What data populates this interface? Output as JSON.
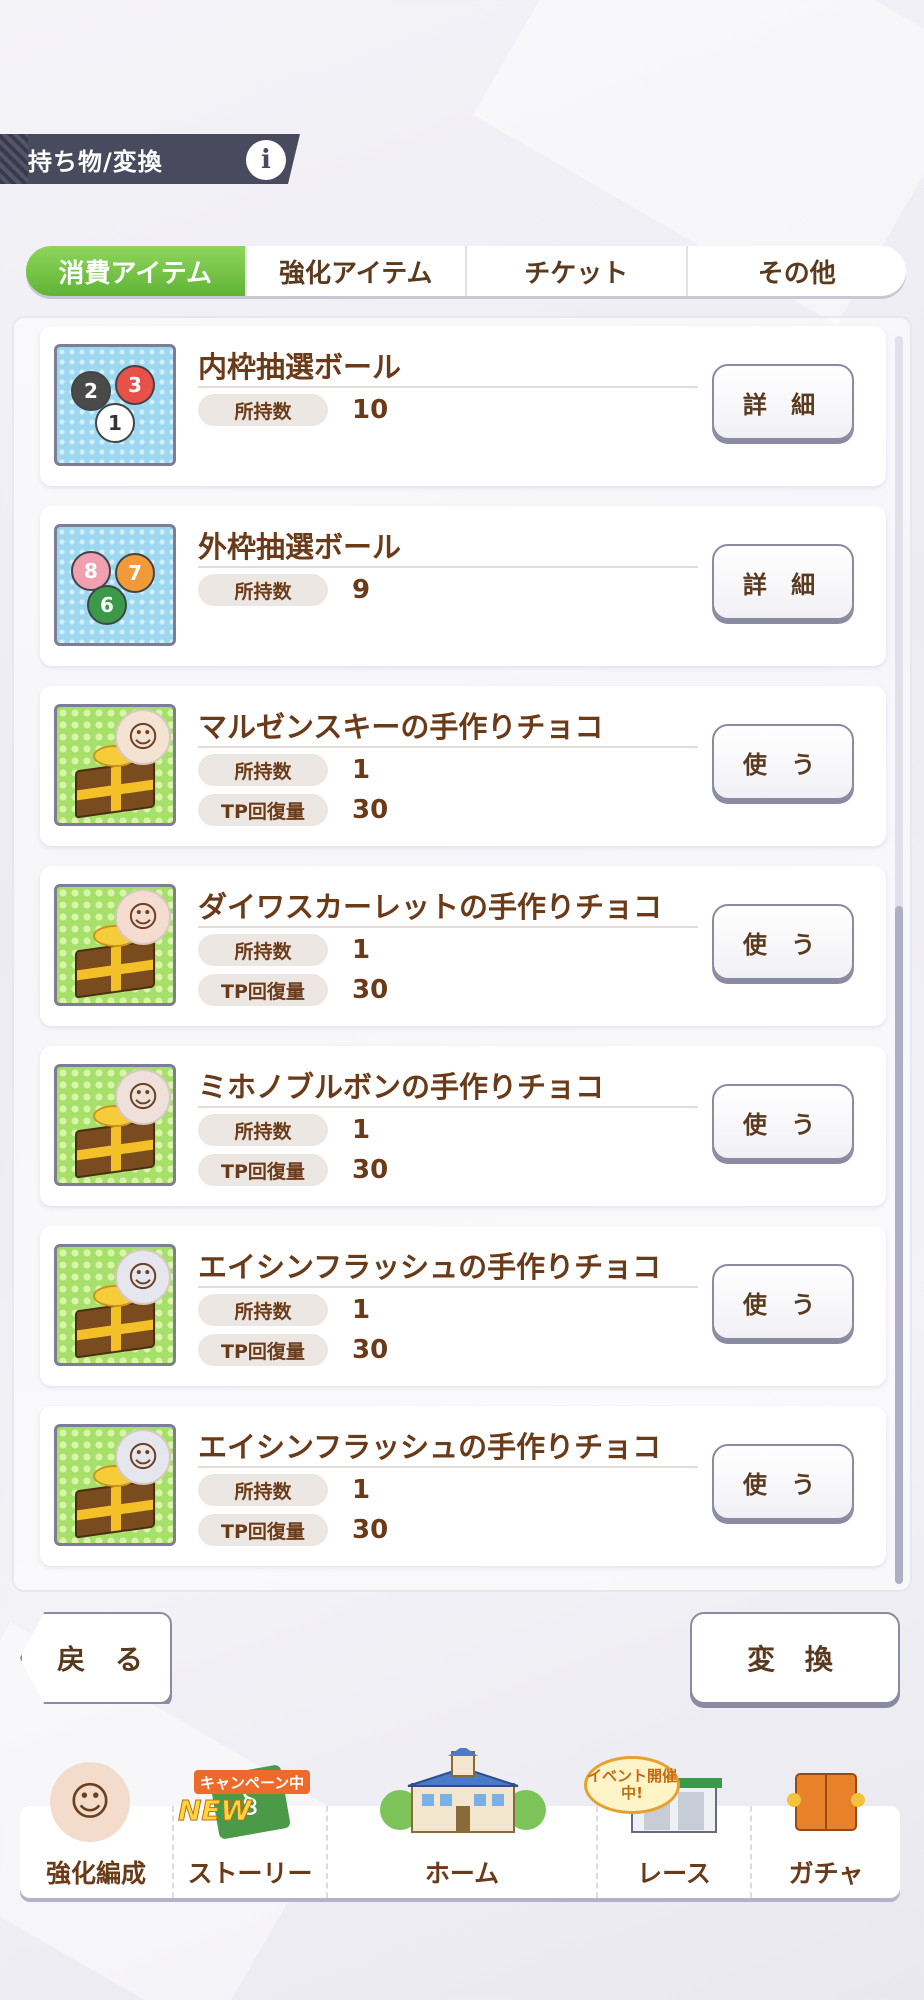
{
  "header": {
    "title": "持ち物/変換",
    "info_icon": "i"
  },
  "tabs": [
    {
      "label": "消費アイテム",
      "active": true
    },
    {
      "label": "強化アイテム",
      "active": false
    },
    {
      "label": "チケット",
      "active": false
    },
    {
      "label": "その他",
      "active": false
    }
  ],
  "items": [
    {
      "name": "内枠抽選ボール",
      "stats": [
        {
          "label": "所持数",
          "value": "10"
        }
      ],
      "button": "詳 細",
      "icon": "inner-lottery-balls-icon"
    },
    {
      "name": "外枠抽選ボール",
      "stats": [
        {
          "label": "所持数",
          "value": "9"
        }
      ],
      "button": "詳 細",
      "icon": "outer-lottery-balls-icon"
    },
    {
      "name": "マルゼンスキーの手作りチョコ",
      "stats": [
        {
          "label": "所持数",
          "value": "1"
        },
        {
          "label": "TP回復量",
          "value": "30"
        }
      ],
      "button": "使 う",
      "icon": "gift-chocolate-icon"
    },
    {
      "name": "ダイワスカーレットの手作りチョコ",
      "stats": [
        {
          "label": "所持数",
          "value": "1"
        },
        {
          "label": "TP回復量",
          "value": "30"
        }
      ],
      "button": "使 う",
      "icon": "gift-chocolate-icon"
    },
    {
      "name": "ミホノブルボンの手作りチョコ",
      "stats": [
        {
          "label": "所持数",
          "value": "1"
        },
        {
          "label": "TP回復量",
          "value": "30"
        }
      ],
      "button": "使 う",
      "icon": "gift-chocolate-icon"
    },
    {
      "name": "エイシンフラッシュの手作りチョコ",
      "stats": [
        {
          "label": "所持数",
          "value": "1"
        },
        {
          "label": "TP回復量",
          "value": "30"
        }
      ],
      "button": "使 う",
      "icon": "gift-chocolate-icon"
    },
    {
      "name": "エイシンフラッシュの手作りチョコ",
      "stats": [
        {
          "label": "所持数",
          "value": "1"
        },
        {
          "label": "TP回復量",
          "value": "30"
        }
      ],
      "button": "使 う",
      "icon": "gift-chocolate-icon"
    }
  ],
  "inner_balls": [
    "2",
    "3",
    "1"
  ],
  "outer_balls": [
    "8",
    "7",
    "6"
  ],
  "footer": {
    "back_label": "戻 る",
    "convert_label": "変 換"
  },
  "nav": {
    "items": [
      {
        "label": "強化編成",
        "icon": "character-portrait-icon"
      },
      {
        "label": "ストーリー",
        "icon": "story-book-icon"
      },
      {
        "label": "ホーム",
        "icon": "school-building-icon"
      },
      {
        "label": "レース",
        "icon": "race-gate-icon"
      },
      {
        "label": "ガチャ",
        "icon": "gacha-door-icon"
      }
    ],
    "campaign_badge": "キャンペーン中",
    "new_badge": "NEW",
    "event_badge": "イベント開催中!"
  },
  "colors": {
    "active_tab": "#5fb436",
    "text_brown": "#6b3a18",
    "header_bg": "#4a4a5e"
  }
}
